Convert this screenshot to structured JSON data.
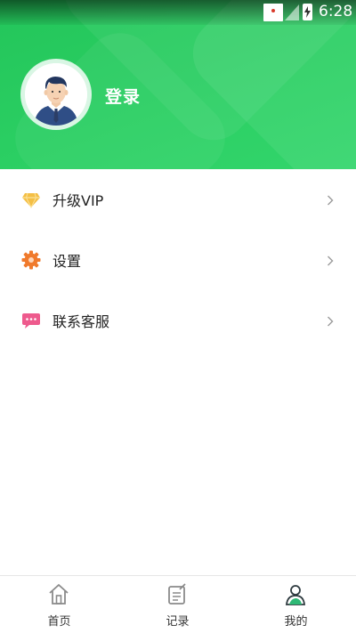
{
  "status_bar": {
    "time": "6:28"
  },
  "profile": {
    "login_label": "登录"
  },
  "menu": {
    "items": [
      {
        "label": "升级VIP",
        "icon": "diamond-icon"
      },
      {
        "label": "设置",
        "icon": "gear-icon"
      },
      {
        "label": "联系客服",
        "icon": "chat-bubble-icon"
      }
    ]
  },
  "bottom_nav": {
    "items": [
      {
        "label": "首页",
        "icon": "home-icon"
      },
      {
        "label": "记录",
        "icon": "record-icon"
      },
      {
        "label": "我的",
        "icon": "profile-icon"
      }
    ],
    "active": "我的"
  },
  "colors": {
    "header_green": "#2bcf63",
    "vip_gold": "#f2b93b",
    "settings_orange": "#f07a2c",
    "service_pink": "#ef5b8e",
    "nav_active": "#2eb875"
  }
}
